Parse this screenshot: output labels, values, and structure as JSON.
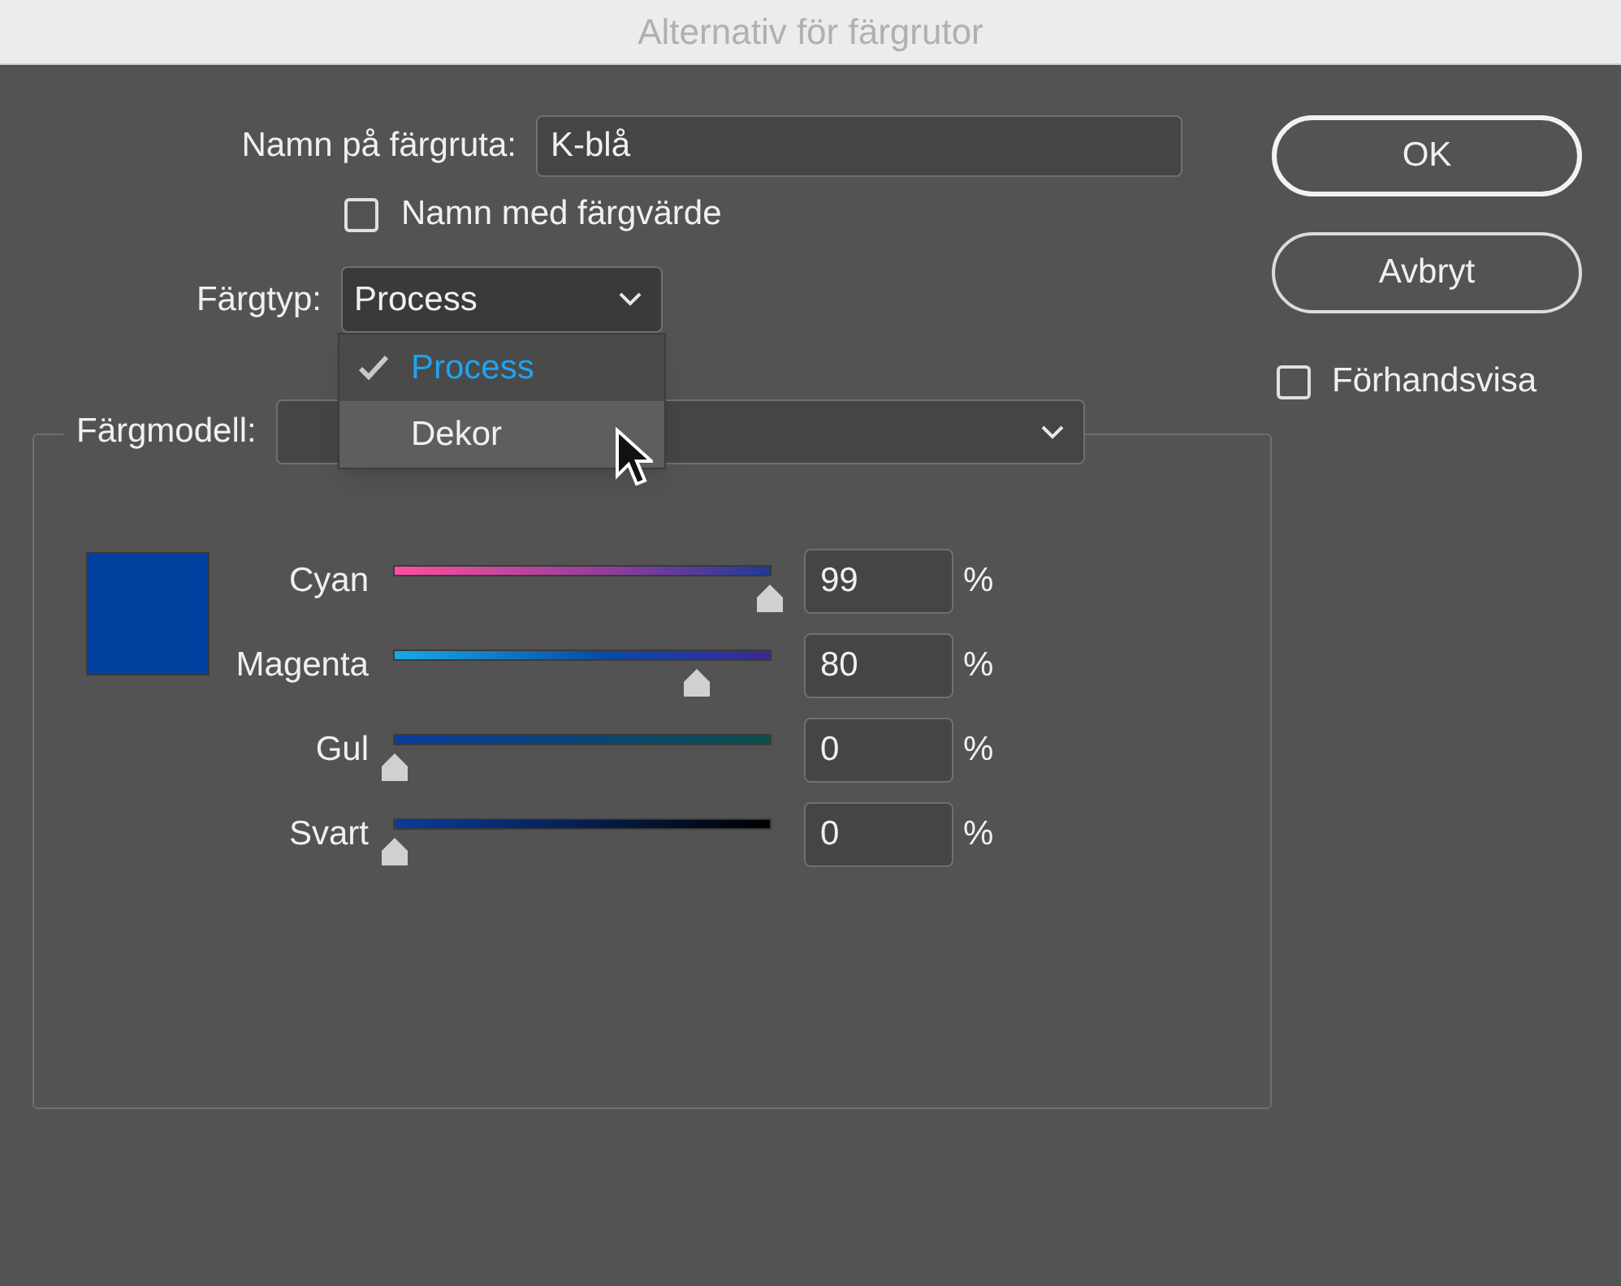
{
  "window": {
    "title": "Alternativ för färgrutor"
  },
  "swatch_name": {
    "label": "Namn på färgruta:",
    "value": "K-blå"
  },
  "name_with_value": {
    "label": "Namn med färgvärde",
    "checked": false
  },
  "color_type": {
    "label": "Färgtyp:",
    "value": "Process",
    "expanded": true,
    "options": [
      {
        "label": "Process",
        "selected": true,
        "highlighted": false
      },
      {
        "label": "Dekor",
        "selected": false,
        "highlighted": true
      }
    ]
  },
  "color_mode": {
    "label": "Färgmodell:"
  },
  "swatch": {
    "color": "#0041a0"
  },
  "channels": [
    {
      "name": "Cyan",
      "level": 0.99,
      "value": "99",
      "unit": "%"
    },
    {
      "name": "Magenta",
      "level": 0.8,
      "value": "80",
      "unit": "%"
    },
    {
      "name": "Gul",
      "level": 0,
      "value": "0",
      "unit": "%"
    },
    {
      "name": "Svart",
      "level": 0,
      "value": "0",
      "unit": "%"
    }
  ],
  "buttons": [
    {
      "label": "OK",
      "default": true
    },
    {
      "label": "Avbryt",
      "default": false
    }
  ],
  "preview": {
    "label": "Förhandsvisa",
    "checked": false
  }
}
